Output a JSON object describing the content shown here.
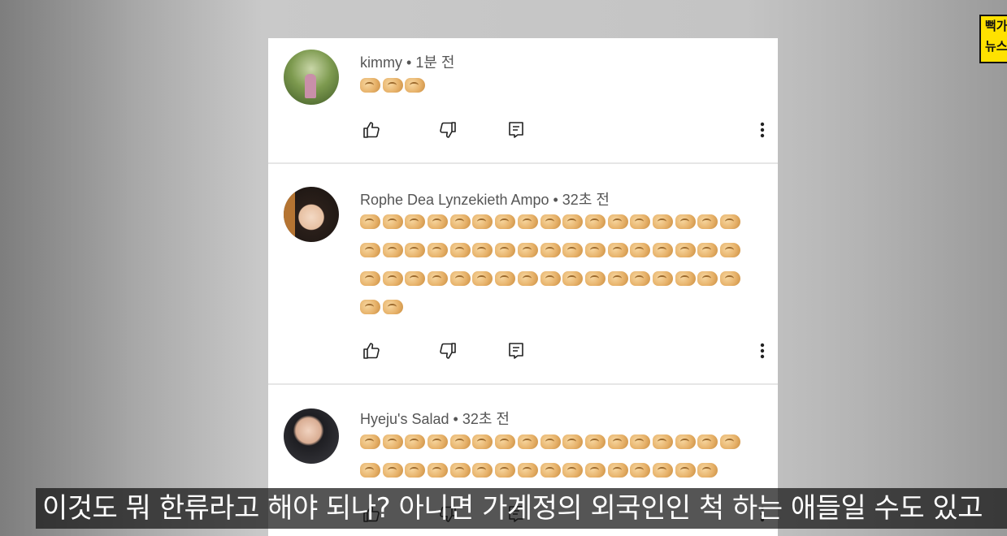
{
  "channel_badge": {
    "line1": "뻑가",
    "line2": "뉴스"
  },
  "comments": [
    {
      "author": "kimmy",
      "time": "1분 전",
      "emoji_count": 3,
      "emoji_name": "pinching-hand-emoji",
      "avatar": "avatar-field"
    },
    {
      "author": "Rophe Dea Lynzekieth Ampo",
      "time": "32초 전",
      "emoji_count": 53,
      "emoji_name": "pinching-hand-emoji",
      "avatar": "avatar-girl"
    },
    {
      "author": "Hyeju's Salad",
      "time": "32초 전",
      "emoji_count": 33,
      "emoji_name": "pinching-hand-emoji",
      "avatar": "avatar-woman"
    }
  ],
  "action_icons": [
    "thumbs-up-icon",
    "thumbs-down-icon",
    "reply-icon",
    "more-vert-icon"
  ],
  "subtitle": "이것도 뭐 한류라고 해야 되나? 아니면 가계정의 외국인인 척 하는 애들일 수도 있고"
}
